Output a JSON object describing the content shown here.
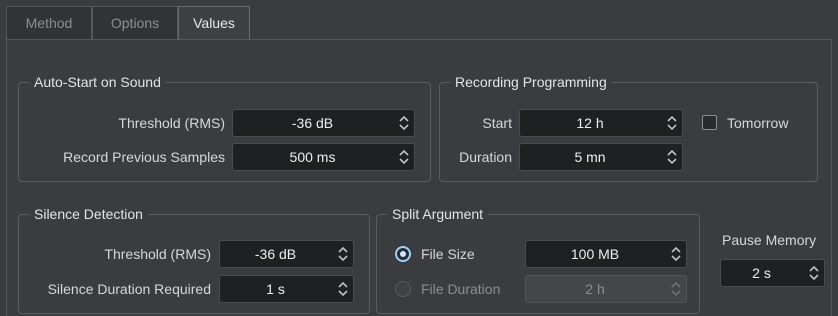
{
  "tabs": [
    {
      "label": "Method",
      "active": false
    },
    {
      "label": "Options",
      "active": false
    },
    {
      "label": "Values",
      "active": true
    }
  ],
  "auto_start": {
    "title": "Auto-Start on Sound",
    "threshold_label": "Threshold (RMS)",
    "threshold_value": "-36 dB",
    "record_prev_label": "Record Previous Samples",
    "record_prev_value": "500 ms"
  },
  "recording_programming": {
    "title": "Recording Programming",
    "start_label": "Start",
    "start_value": "12 h",
    "tomorrow_label": "Tomorrow",
    "tomorrow_checked": false,
    "duration_label": "Duration",
    "duration_value": "5 mn"
  },
  "silence_detection": {
    "title": "Silence Detection",
    "threshold_label": "Threshold (RMS)",
    "threshold_value": "-36 dB",
    "duration_label": "Silence Duration Required",
    "duration_value": "1 s"
  },
  "split_argument": {
    "title": "Split Argument",
    "file_size_label": "File Size",
    "file_size_value": "100 MB",
    "file_size_selected": true,
    "file_duration_label": "File Duration",
    "file_duration_value": "2 h",
    "file_duration_selected": false
  },
  "pause_memory": {
    "label": "Pause Memory",
    "value": "2 s"
  },
  "colors": {
    "background": "#3b3c40",
    "field": "#1f2022",
    "radio_accent": "#9ed0ff"
  }
}
